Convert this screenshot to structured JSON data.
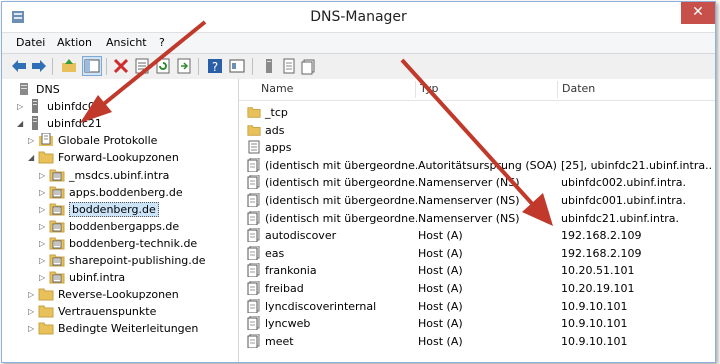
{
  "window": {
    "title": "DNS-Manager",
    "close_glyph": "✕"
  },
  "menu": [
    "Datei",
    "Aktion",
    "Ansicht",
    "?"
  ],
  "toolbar": [
    "back-arrow-icon",
    "forward-arrow-icon",
    "up-folder-icon",
    "show-hide-tree-icon",
    "delete-icon",
    "properties-icon",
    "refresh-icon",
    "export-list-icon",
    "help-icon",
    "mmc-view-icon",
    "server-icon",
    "zone-icon",
    "record-icon"
  ],
  "tree": [
    {
      "label": "DNS",
      "icon": "dns-icon",
      "expander": "",
      "indent": 0
    },
    {
      "label": "ubinfdc001",
      "icon": "server-icon",
      "expander": "▷",
      "indent": 1
    },
    {
      "label": "ubinfdc21",
      "icon": "server-icon",
      "expander": "◢",
      "indent": 1
    },
    {
      "label": "Globale Protokolle",
      "icon": "log-icon",
      "expander": "▷",
      "indent": 2
    },
    {
      "label": "Forward-Lookupzonen",
      "icon": "folder-icon",
      "expander": "◢",
      "indent": 2
    },
    {
      "label": "_msdcs.ubinf.intra",
      "icon": "zone-icon",
      "expander": "▷",
      "indent": 3
    },
    {
      "label": "apps.boddenberg.de",
      "icon": "zone-icon",
      "expander": "▷",
      "indent": 3
    },
    {
      "label": "boddenberg.de",
      "icon": "zone-icon",
      "expander": "▷",
      "indent": 3,
      "selected": true
    },
    {
      "label": "boddenbergapps.de",
      "icon": "zone-icon",
      "expander": "▷",
      "indent": 3
    },
    {
      "label": "boddenberg-technik.de",
      "icon": "zone-icon",
      "expander": "▷",
      "indent": 3
    },
    {
      "label": "sharepoint-publishing.de",
      "icon": "zone-icon",
      "expander": "▷",
      "indent": 3
    },
    {
      "label": "ubinf.intra",
      "icon": "zone-icon",
      "expander": "▷",
      "indent": 3
    },
    {
      "label": "Reverse-Lookupzonen",
      "icon": "folder-icon",
      "expander": "▷",
      "indent": 2
    },
    {
      "label": "Vertrauenspunkte",
      "icon": "folder-icon",
      "expander": "▷",
      "indent": 2
    },
    {
      "label": "Bedingte Weiterleitungen",
      "icon": "folder-icon",
      "expander": "▷",
      "indent": 2
    }
  ],
  "columns": {
    "name": "Name",
    "type": "Typ",
    "data": "Daten"
  },
  "records": [
    {
      "name": "_tcp",
      "type": "",
      "data": "",
      "icon": "folder-icon"
    },
    {
      "name": "ads",
      "type": "",
      "data": "",
      "icon": "folder-icon"
    },
    {
      "name": "apps",
      "type": "",
      "data": "",
      "icon": "delegation-icon"
    },
    {
      "name": "(identisch mit übergeordne...",
      "type": "Autoritätsursprung (SOA)",
      "data": "[25], ubinfdc21.ubinf.intra...",
      "icon": "record-icon"
    },
    {
      "name": "(identisch mit übergeordne...",
      "type": "Namenserver (NS)",
      "data": "ubinfdc002.ubinf.intra.",
      "icon": "record-icon"
    },
    {
      "name": "(identisch mit übergeordne...",
      "type": "Namenserver (NS)",
      "data": "ubinfdc001.ubinf.intra.",
      "icon": "record-icon"
    },
    {
      "name": "(identisch mit übergeordne...",
      "type": "Namenserver (NS)",
      "data": "ubinfdc21.ubinf.intra.",
      "icon": "record-icon"
    },
    {
      "name": "autodiscover",
      "type": "Host (A)",
      "data": "192.168.2.109",
      "icon": "record-icon"
    },
    {
      "name": "eas",
      "type": "Host (A)",
      "data": "192.168.2.109",
      "icon": "record-icon"
    },
    {
      "name": "frankonia",
      "type": "Host (A)",
      "data": "10.20.51.101",
      "icon": "record-icon"
    },
    {
      "name": "freibad",
      "type": "Host (A)",
      "data": "10.20.19.101",
      "icon": "record-icon"
    },
    {
      "name": "lyncdiscoverinternal",
      "type": "Host (A)",
      "data": "10.9.10.101",
      "icon": "record-icon"
    },
    {
      "name": "lyncweb",
      "type": "Host (A)",
      "data": "10.9.10.101",
      "icon": "record-icon"
    },
    {
      "name": "meet",
      "type": "Host (A)",
      "data": "10.9.10.101",
      "icon": "record-icon"
    }
  ],
  "colors": {
    "annotation_arrow": "#c0392b",
    "close": "#c7504a",
    "folder": "#e8c15a",
    "selection": "#cce4f7"
  }
}
